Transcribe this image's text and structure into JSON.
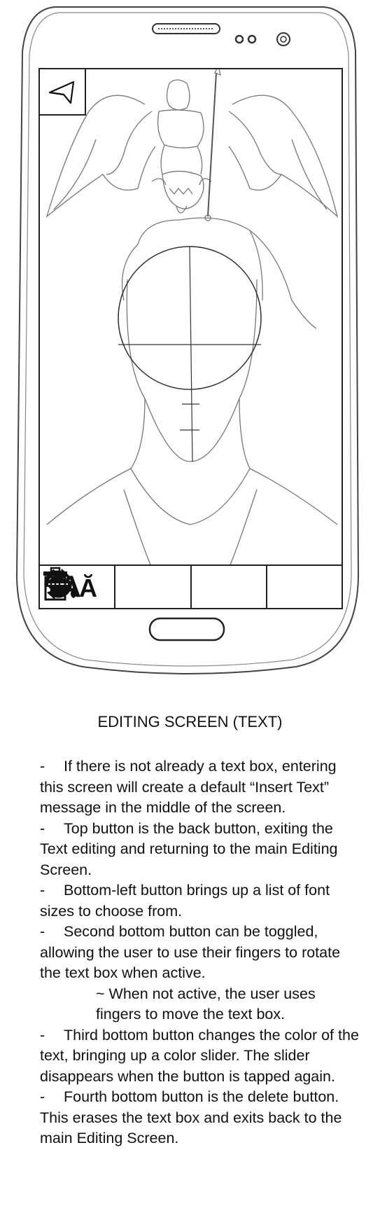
{
  "caption": "EDITING SCREEN (TEXT)",
  "toolbar": {
    "font_glyph_large": "A",
    "font_glyph_small": "Ă"
  },
  "notes": [
    {
      "dash": "-",
      "text": "If there is not already a text box, entering this screen will create a default “Insert Text” message in the middle of the screen."
    },
    {
      "dash": "-",
      "text": "Top button is the back button, exiting the Text editing and returning to the main Editing Screen."
    },
    {
      "dash": "-",
      "text": "Bottom-left button brings up a list of font sizes to choose from."
    },
    {
      "dash": "-",
      "text": "Second bottom button can be toggled, allowing the user to use their fingers to rotate the text box when active."
    },
    {
      "sub": "~ When not active, the user uses fingers to move the text box."
    },
    {
      "dash": "-",
      "text": "Third bottom button changes the color of the text, bringing up a color slider. The slider disappears when the button is tapped again."
    },
    {
      "dash": "-",
      "text": "Fourth bottom button is the delete button. This erases the text box and exits back to the main Editing Screen."
    }
  ],
  "icons": [
    "back-arrow-icon",
    "font-size-icon",
    "rotate-icon",
    "paint-bucket-icon",
    "trash-icon"
  ]
}
